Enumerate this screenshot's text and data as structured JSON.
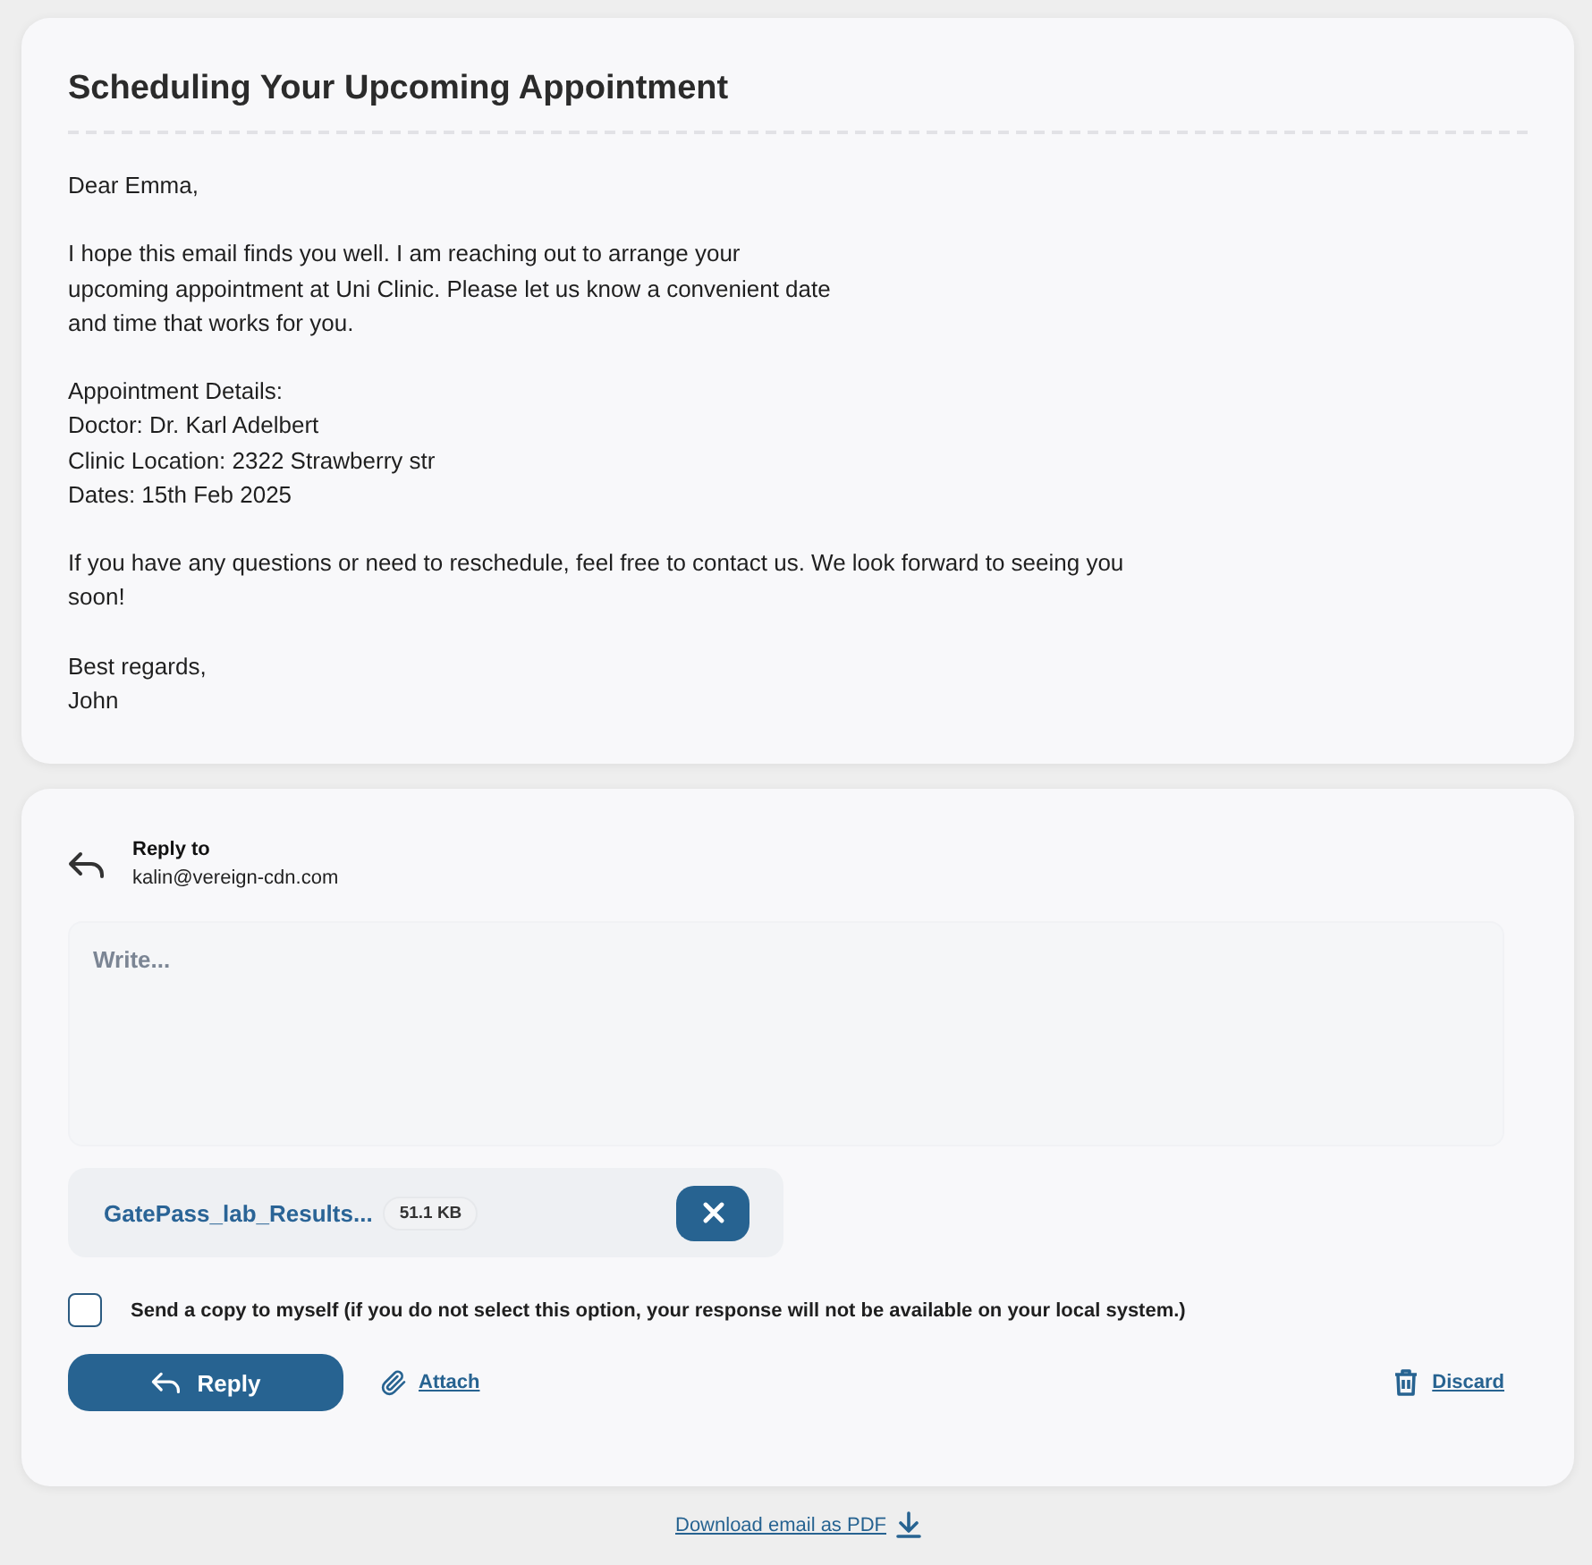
{
  "email": {
    "title": "Scheduling Your Upcoming Appointment",
    "paragraphs": [
      [
        "Dear Emma,"
      ],
      [
        "I hope this email finds you well. I am reaching out to arrange your",
        "upcoming appointment at Uni Clinic. Please let us know a convenient date",
        "and time that works for you."
      ],
      [
        "Appointment Details:",
        "Doctor: Dr. Karl Adelbert",
        "Clinic Location: 2322 Strawberry str",
        "Dates: 15th Feb 2025"
      ],
      [
        "If you have any questions or need to reschedule, feel free to contact us. We look forward to seeing you soon!"
      ],
      [
        "Best regards,",
        "John"
      ]
    ]
  },
  "reply": {
    "label": "Reply to",
    "address": "kalin@vereign-cdn.com",
    "message": {
      "placeholder": "Write..."
    },
    "attachments": [
      {
        "name": "GatePass_lab_Results...",
        "size": "51.1 KB"
      }
    ],
    "copy_to_self": {
      "label": "Send a copy to myself (if you do not select this option, your response will not be available on your local system.)",
      "checked": false
    },
    "actions": [
      {
        "kind": "send",
        "label": "Reply"
      },
      {
        "kind": "attach",
        "label": "Attach"
      },
      {
        "kind": "discard",
        "label": "Discard"
      }
    ]
  },
  "download": {
    "label": "Download email as PDF"
  }
}
